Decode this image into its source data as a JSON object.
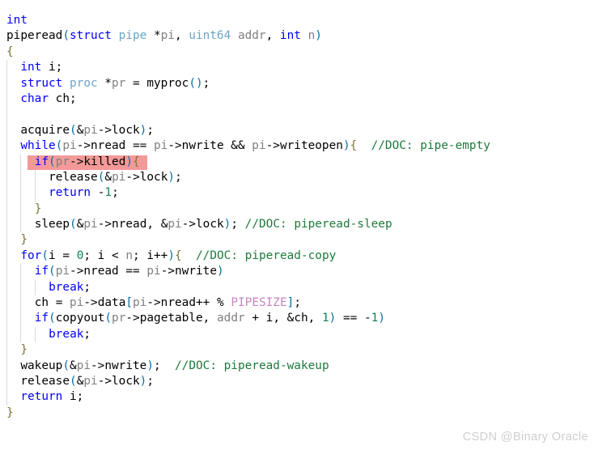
{
  "editor": {
    "language": "c",
    "background_color": "#ffffff",
    "highlight_color": "#f39a98",
    "comment_color": "#1e7a3c",
    "keyword_color": "#0000ff",
    "type_color": "#6aa6c8",
    "variable_color": "#808080",
    "macro_color": "#c586c0",
    "number_color": "#098658",
    "brace_color": "#7c7336",
    "paren_color": "#0b6fa4",
    "indent_guide_color": "#d8d8d8"
  },
  "code": {
    "lines": [
      {
        "indent": 0,
        "guides": 0,
        "highlighted": false,
        "tokens": [
          {
            "t": "int",
            "c": "kw"
          }
        ]
      },
      {
        "indent": 0,
        "guides": 0,
        "highlighted": false,
        "tokens": [
          {
            "t": "piperead",
            "c": "fn"
          },
          {
            "t": "(",
            "c": "punct"
          },
          {
            "t": "struct",
            "c": "kw"
          },
          {
            "t": " ",
            "c": "op"
          },
          {
            "t": "pipe",
            "c": "type"
          },
          {
            "t": " *",
            "c": "op"
          },
          {
            "t": "pi",
            "c": "var"
          },
          {
            "t": ", ",
            "c": "op"
          },
          {
            "t": "uint64",
            "c": "type"
          },
          {
            "t": " ",
            "c": "op"
          },
          {
            "t": "addr",
            "c": "var"
          },
          {
            "t": ", ",
            "c": "op"
          },
          {
            "t": "int",
            "c": "kw"
          },
          {
            "t": " ",
            "c": "op"
          },
          {
            "t": "n",
            "c": "var"
          },
          {
            "t": ")",
            "c": "punct"
          }
        ]
      },
      {
        "indent": 0,
        "guides": 0,
        "highlighted": false,
        "tokens": [
          {
            "t": "{",
            "c": "brace"
          }
        ]
      },
      {
        "indent": 1,
        "guides": 1,
        "highlighted": false,
        "tokens": [
          {
            "t": "int",
            "c": "kw"
          },
          {
            "t": " i;",
            "c": "op"
          }
        ]
      },
      {
        "indent": 1,
        "guides": 1,
        "highlighted": false,
        "tokens": [
          {
            "t": "struct",
            "c": "kw"
          },
          {
            "t": " ",
            "c": "op"
          },
          {
            "t": "proc",
            "c": "type"
          },
          {
            "t": " *",
            "c": "op"
          },
          {
            "t": "pr",
            "c": "var"
          },
          {
            "t": " = ",
            "c": "op"
          },
          {
            "t": "myproc",
            "c": "fn"
          },
          {
            "t": "()",
            "c": "punct"
          },
          {
            "t": ";",
            "c": "op"
          }
        ]
      },
      {
        "indent": 1,
        "guides": 1,
        "highlighted": false,
        "tokens": [
          {
            "t": "char",
            "c": "kw"
          },
          {
            "t": " ch;",
            "c": "op"
          }
        ]
      },
      {
        "indent": 0,
        "guides": 1,
        "highlighted": false,
        "tokens": []
      },
      {
        "indent": 1,
        "guides": 1,
        "highlighted": false,
        "tokens": [
          {
            "t": "acquire",
            "c": "fn"
          },
          {
            "t": "(",
            "c": "punct"
          },
          {
            "t": "&",
            "c": "op"
          },
          {
            "t": "pi",
            "c": "var"
          },
          {
            "t": "->lock",
            "c": "op"
          },
          {
            "t": ")",
            "c": "punct"
          },
          {
            "t": ";",
            "c": "op"
          }
        ]
      },
      {
        "indent": 1,
        "guides": 1,
        "highlighted": false,
        "tokens": [
          {
            "t": "while",
            "c": "kw"
          },
          {
            "t": "(",
            "c": "punct"
          },
          {
            "t": "pi",
            "c": "var"
          },
          {
            "t": "->nread == ",
            "c": "op"
          },
          {
            "t": "pi",
            "c": "var"
          },
          {
            "t": "->nwrite && ",
            "c": "op"
          },
          {
            "t": "pi",
            "c": "var"
          },
          {
            "t": "->writeopen",
            "c": "op"
          },
          {
            "t": ")",
            "c": "punct"
          },
          {
            "t": "{",
            "c": "brace"
          },
          {
            "t": "  ",
            "c": "op"
          },
          {
            "t": "//DOC: pipe-empty",
            "c": "cmt"
          }
        ]
      },
      {
        "indent": 2,
        "guides": 2,
        "highlighted": true,
        "hl_start": 30,
        "hl_width": 148,
        "tokens": [
          {
            "t": "if",
            "c": "kw"
          },
          {
            "t": "(",
            "c": "punct"
          },
          {
            "t": "pr",
            "c": "var"
          },
          {
            "t": "->killed",
            "c": "op"
          },
          {
            "t": ")",
            "c": "punct"
          },
          {
            "t": "{",
            "c": "brace"
          }
        ]
      },
      {
        "indent": 3,
        "guides": 3,
        "highlighted": false,
        "tokens": [
          {
            "t": "release",
            "c": "fn"
          },
          {
            "t": "(",
            "c": "punct"
          },
          {
            "t": "&",
            "c": "op"
          },
          {
            "t": "pi",
            "c": "var"
          },
          {
            "t": "->lock",
            "c": "op"
          },
          {
            "t": ")",
            "c": "punct"
          },
          {
            "t": ";",
            "c": "op"
          }
        ]
      },
      {
        "indent": 3,
        "guides": 3,
        "highlighted": false,
        "tokens": [
          {
            "t": "return",
            "c": "kw"
          },
          {
            "t": " -",
            "c": "op"
          },
          {
            "t": "1",
            "c": "num"
          },
          {
            "t": ";",
            "c": "op"
          }
        ]
      },
      {
        "indent": 2,
        "guides": 2,
        "highlighted": false,
        "tokens": [
          {
            "t": "}",
            "c": "brace"
          }
        ]
      },
      {
        "indent": 2,
        "guides": 2,
        "highlighted": false,
        "tokens": [
          {
            "t": "sleep",
            "c": "fn"
          },
          {
            "t": "(",
            "c": "punct"
          },
          {
            "t": "&",
            "c": "op"
          },
          {
            "t": "pi",
            "c": "var"
          },
          {
            "t": "->nread, &",
            "c": "op"
          },
          {
            "t": "pi",
            "c": "var"
          },
          {
            "t": "->lock",
            "c": "op"
          },
          {
            "t": ")",
            "c": "punct"
          },
          {
            "t": "; ",
            "c": "op"
          },
          {
            "t": "//DOC: piperead-sleep",
            "c": "cmt"
          }
        ]
      },
      {
        "indent": 1,
        "guides": 1,
        "highlighted": false,
        "tokens": [
          {
            "t": "}",
            "c": "brace"
          }
        ]
      },
      {
        "indent": 1,
        "guides": 1,
        "highlighted": false,
        "tokens": [
          {
            "t": "for",
            "c": "kw"
          },
          {
            "t": "(",
            "c": "punct"
          },
          {
            "t": "i = ",
            "c": "op"
          },
          {
            "t": "0",
            "c": "num"
          },
          {
            "t": "; i < ",
            "c": "op"
          },
          {
            "t": "n",
            "c": "var"
          },
          {
            "t": "; i++",
            "c": "op"
          },
          {
            "t": ")",
            "c": "punct"
          },
          {
            "t": "{",
            "c": "brace"
          },
          {
            "t": "  ",
            "c": "op"
          },
          {
            "t": "//DOC: piperead-copy",
            "c": "cmt"
          }
        ]
      },
      {
        "indent": 2,
        "guides": 2,
        "highlighted": false,
        "tokens": [
          {
            "t": "if",
            "c": "kw"
          },
          {
            "t": "(",
            "c": "punct"
          },
          {
            "t": "pi",
            "c": "var"
          },
          {
            "t": "->nread == ",
            "c": "op"
          },
          {
            "t": "pi",
            "c": "var"
          },
          {
            "t": "->nwrite",
            "c": "op"
          },
          {
            "t": ")",
            "c": "punct"
          }
        ]
      },
      {
        "indent": 3,
        "guides": 3,
        "highlighted": false,
        "tokens": [
          {
            "t": "break",
            "c": "kw"
          },
          {
            "t": ";",
            "c": "op"
          }
        ]
      },
      {
        "indent": 2,
        "guides": 2,
        "highlighted": false,
        "tokens": [
          {
            "t": "ch = ",
            "c": "op"
          },
          {
            "t": "pi",
            "c": "var"
          },
          {
            "t": "->data",
            "c": "op"
          },
          {
            "t": "[",
            "c": "punct"
          },
          {
            "t": "pi",
            "c": "var"
          },
          {
            "t": "->nread++ % ",
            "c": "op"
          },
          {
            "t": "PIPESIZE",
            "c": "macro"
          },
          {
            "t": "]",
            "c": "punct"
          },
          {
            "t": ";",
            "c": "op"
          }
        ]
      },
      {
        "indent": 2,
        "guides": 2,
        "highlighted": false,
        "tokens": [
          {
            "t": "if",
            "c": "kw"
          },
          {
            "t": "(",
            "c": "punct"
          },
          {
            "t": "copyout",
            "c": "fn"
          },
          {
            "t": "(",
            "c": "punct"
          },
          {
            "t": "pr",
            "c": "var"
          },
          {
            "t": "->pagetable, ",
            "c": "op"
          },
          {
            "t": "addr",
            "c": "var"
          },
          {
            "t": " + i, &ch, ",
            "c": "op"
          },
          {
            "t": "1",
            "c": "num"
          },
          {
            "t": ")",
            "c": "punct"
          },
          {
            "t": " == -",
            "c": "op"
          },
          {
            "t": "1",
            "c": "num"
          },
          {
            "t": ")",
            "c": "punct"
          }
        ]
      },
      {
        "indent": 3,
        "guides": 3,
        "highlighted": false,
        "tokens": [
          {
            "t": "break",
            "c": "kw"
          },
          {
            "t": ";",
            "c": "op"
          }
        ]
      },
      {
        "indent": 1,
        "guides": 1,
        "highlighted": false,
        "tokens": [
          {
            "t": "}",
            "c": "brace"
          }
        ]
      },
      {
        "indent": 1,
        "guides": 1,
        "highlighted": false,
        "tokens": [
          {
            "t": "wakeup",
            "c": "fn"
          },
          {
            "t": "(",
            "c": "punct"
          },
          {
            "t": "&",
            "c": "op"
          },
          {
            "t": "pi",
            "c": "var"
          },
          {
            "t": "->nwrite",
            "c": "op"
          },
          {
            "t": ")",
            "c": "punct"
          },
          {
            "t": ";  ",
            "c": "op"
          },
          {
            "t": "//DOC: piperead-wakeup",
            "c": "cmt"
          }
        ]
      },
      {
        "indent": 1,
        "guides": 1,
        "highlighted": false,
        "tokens": [
          {
            "t": "release",
            "c": "fn"
          },
          {
            "t": "(",
            "c": "punct"
          },
          {
            "t": "&",
            "c": "op"
          },
          {
            "t": "pi",
            "c": "var"
          },
          {
            "t": "->lock",
            "c": "op"
          },
          {
            "t": ")",
            "c": "punct"
          },
          {
            "t": ";",
            "c": "op"
          }
        ]
      },
      {
        "indent": 1,
        "guides": 1,
        "highlighted": false,
        "tokens": [
          {
            "t": "return",
            "c": "kw"
          },
          {
            "t": " i;",
            "c": "op"
          }
        ]
      },
      {
        "indent": 0,
        "guides": 0,
        "highlighted": false,
        "tokens": [
          {
            "t": "}",
            "c": "brace"
          }
        ]
      }
    ]
  },
  "watermark": {
    "text": "CSDN @Binary Oracle"
  }
}
